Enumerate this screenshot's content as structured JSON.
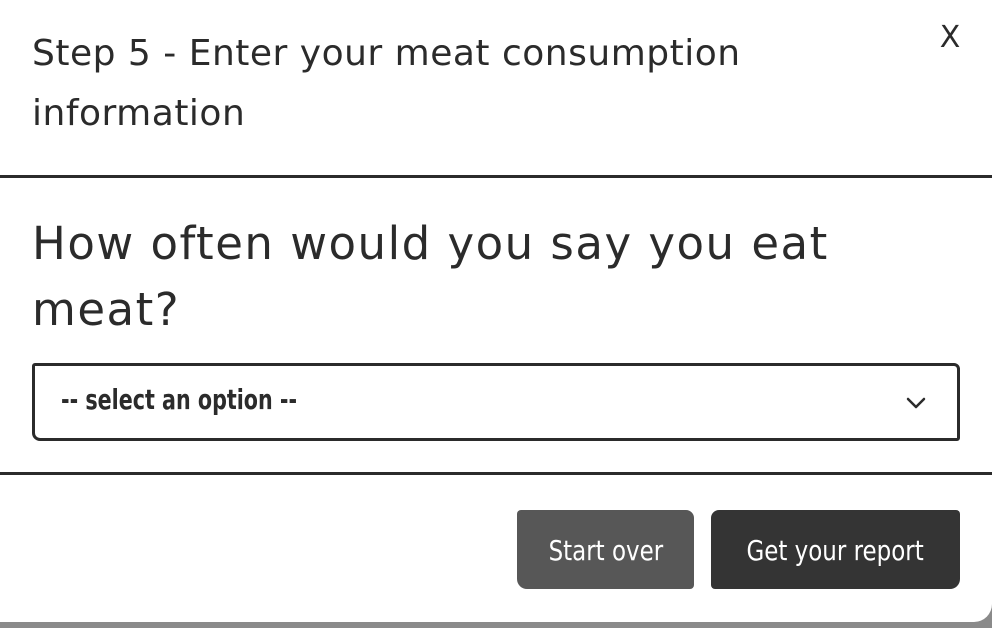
{
  "modal": {
    "title": "Step 5 - Enter your meat consumption information",
    "close_label": "X"
  },
  "question": {
    "text": "How often would you say you eat meat?"
  },
  "select": {
    "selected_value": "-- select an option --"
  },
  "footer": {
    "start_over_label": "Start over",
    "report_label": "Get your report"
  },
  "colors": {
    "text": "#2b2b2b",
    "start_over_bg": "#575757",
    "report_bg": "#343434",
    "backdrop": "#8a8a8a"
  },
  "icons": {
    "select": "chevron-down-icon"
  }
}
